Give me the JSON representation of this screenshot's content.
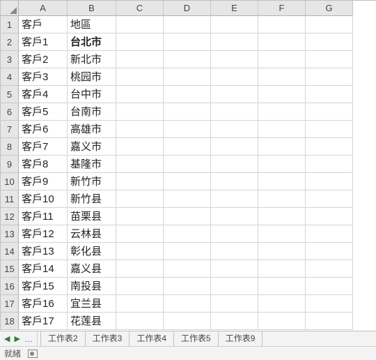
{
  "columns": [
    "A",
    "B",
    "C",
    "D",
    "E",
    "F",
    "G"
  ],
  "row_numbers": [
    1,
    2,
    3,
    4,
    5,
    6,
    7,
    8,
    9,
    10,
    11,
    12,
    13,
    14,
    15,
    16,
    17,
    18
  ],
  "header_row": {
    "A": "客戶",
    "B": "地區"
  },
  "bold_cells": [
    "B2"
  ],
  "data": [
    {
      "A": "客戶1",
      "B": "台北市"
    },
    {
      "A": "客戶2",
      "B": "新北市"
    },
    {
      "A": "客戶3",
      "B": "桃园市"
    },
    {
      "A": "客戶4",
      "B": "台中市"
    },
    {
      "A": "客戶5",
      "B": "台南市"
    },
    {
      "A": "客戶6",
      "B": "高雄市"
    },
    {
      "A": "客戶7",
      "B": "嘉义市"
    },
    {
      "A": "客戶8",
      "B": "基隆市"
    },
    {
      "A": "客戶9",
      "B": "新竹市"
    },
    {
      "A": "客戶10",
      "B": "新竹县"
    },
    {
      "A": "客戶11",
      "B": "苗栗县"
    },
    {
      "A": "客戶12",
      "B": "云林县"
    },
    {
      "A": "客戶13",
      "B": "彰化县"
    },
    {
      "A": "客戶14",
      "B": "嘉义县"
    },
    {
      "A": "客戶15",
      "B": "南投县"
    },
    {
      "A": "客戶16",
      "B": "宜兰县"
    },
    {
      "A": "客戶17",
      "B": "花莲县"
    }
  ],
  "sheet_tabs": [
    "工作表2",
    "工作表3",
    "工作表4",
    "工作表5",
    "工作表9"
  ],
  "statusbar": {
    "ready": "就緒"
  }
}
